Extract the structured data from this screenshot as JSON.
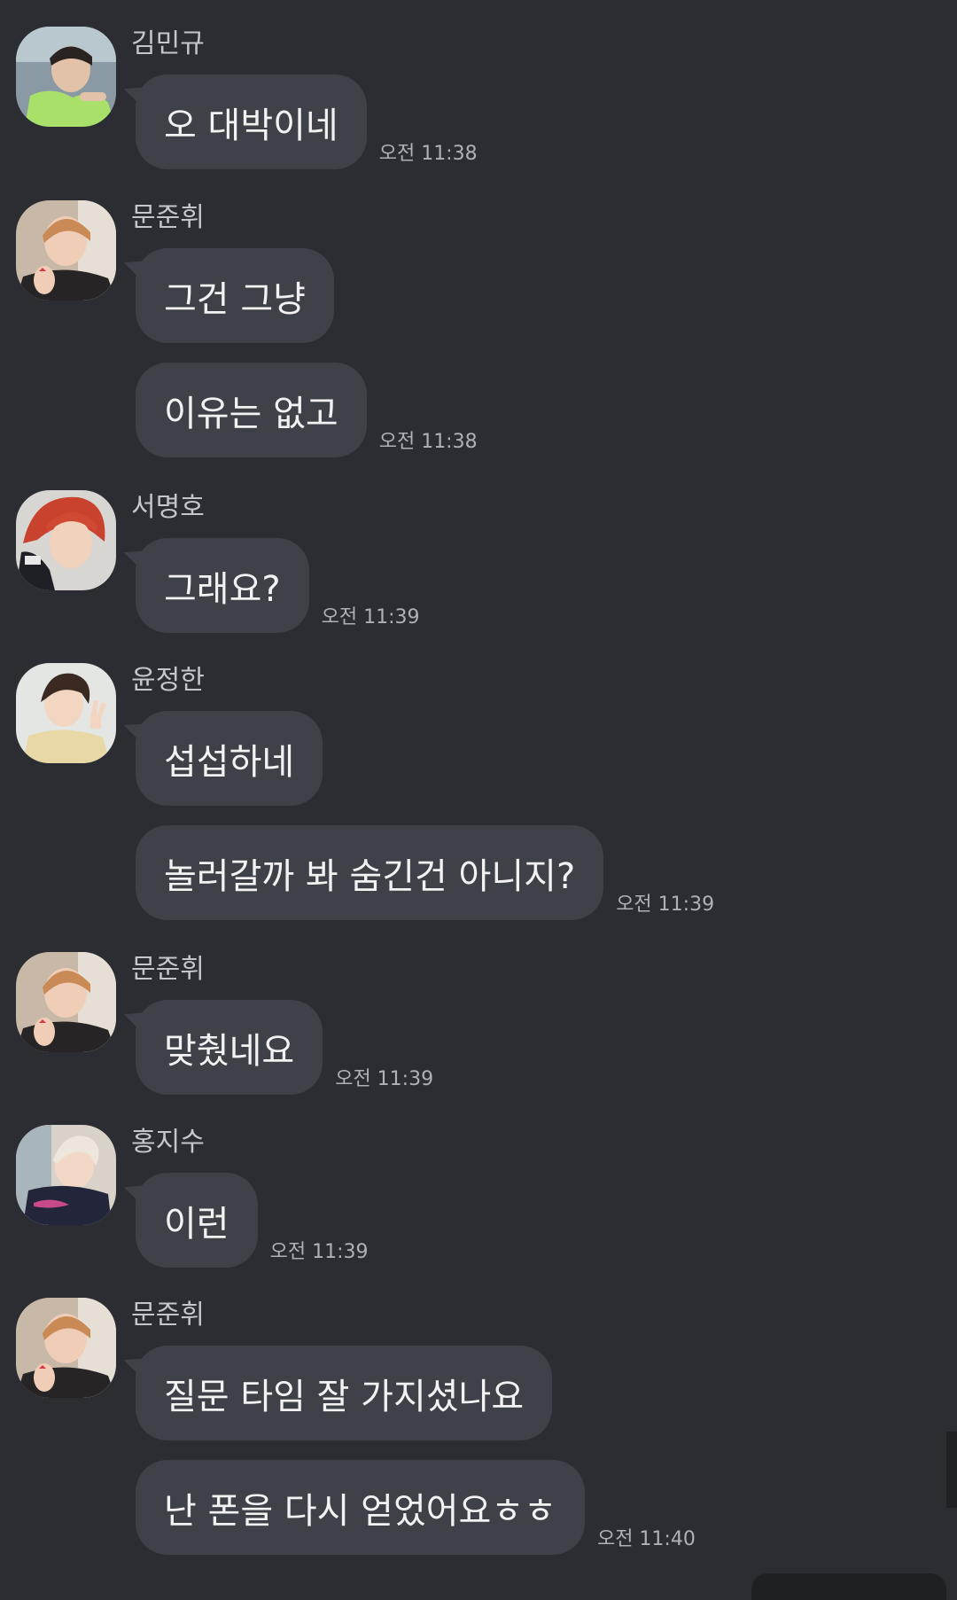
{
  "groups": [
    {
      "sender": "김민규",
      "avatar": "avatar-kim-mingyu-icon",
      "messages": [
        "오 대박이네"
      ],
      "time": "오전 11:38"
    },
    {
      "sender": "문준휘",
      "avatar": "avatar-moon-junhui-icon",
      "messages": [
        "그건 그냥",
        "이유는 없고"
      ],
      "time": "오전 11:38"
    },
    {
      "sender": "서명호",
      "avatar": "avatar-seo-myungho-icon",
      "messages": [
        "그래요?"
      ],
      "time": "오전 11:39"
    },
    {
      "sender": "윤정한",
      "avatar": "avatar-yoon-jeonghan-icon",
      "messages": [
        "섭섭하네",
        "놀러갈까 봐 숨긴건 아니지?"
      ],
      "time": "오전 11:39"
    },
    {
      "sender": "문준휘",
      "avatar": "avatar-moon-junhui-icon",
      "messages": [
        "맞췄네요"
      ],
      "time": "오전 11:39"
    },
    {
      "sender": "홍지수",
      "avatar": "avatar-hong-jisoo-icon",
      "messages": [
        "이런"
      ],
      "time": "오전 11:39"
    },
    {
      "sender": "문준휘",
      "avatar": "avatar-moon-junhui-icon",
      "messages": [
        "질문 타임 잘 가지셨나요",
        "난 폰을 다시 얻었어요ㅎㅎ"
      ],
      "time": "오전 11:40"
    }
  ],
  "colors": {
    "background": "#2b2d33",
    "bubble": "#3e4148",
    "text": "#f2f2f2",
    "name": "#c4c6cb",
    "time": "#aeb1b7"
  }
}
